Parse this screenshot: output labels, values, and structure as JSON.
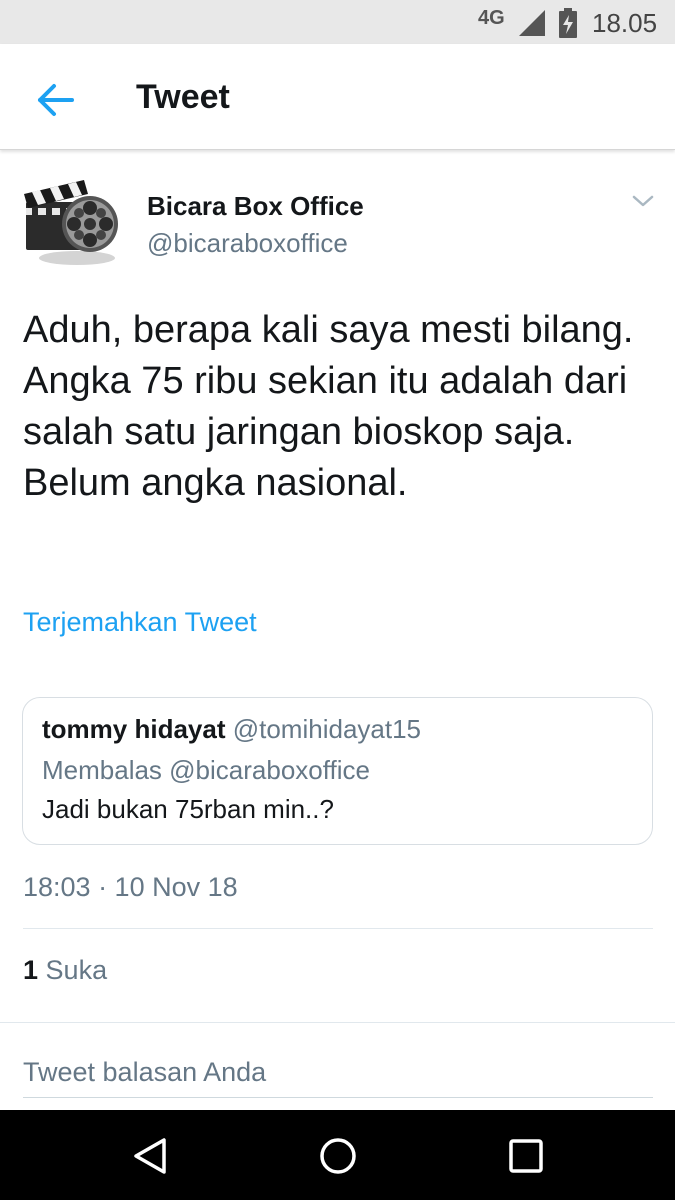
{
  "status_bar": {
    "network": "4G",
    "time": "18.05"
  },
  "app_bar": {
    "title": "Tweet"
  },
  "tweet": {
    "author_name": "Bicara Box Office",
    "author_handle": "@bicaraboxoffice",
    "text": "Aduh, berapa kali saya mesti bilang. Angka 75 ribu sekian itu adalah dari salah satu jaringan bioskop saja. Belum angka nasional.",
    "translate_label": "Terjemahkan Tweet",
    "timestamp": "18:03 · 10 Nov 18",
    "likes_count": "1",
    "likes_label": "Suka"
  },
  "quoted_tweet": {
    "author_name": "tommy hidayat",
    "author_handle": "@tomihidayat15",
    "reply_context": "Membalas @bicaraboxoffice",
    "text": "Jadi bukan 75rban min..?"
  },
  "reply": {
    "placeholder": "Tweet balasan Anda"
  },
  "colors": {
    "accent": "#1da1f2",
    "secondary_text": "#657786",
    "primary_text": "#14171a"
  },
  "icons": {
    "back": "arrow-left-icon",
    "avatar": "film-clapper-reel-icon",
    "menu": "chevron-down-icon",
    "nav_back": "triangle-back-icon",
    "nav_home": "circle-home-icon",
    "nav_recents": "square-recents-icon"
  }
}
